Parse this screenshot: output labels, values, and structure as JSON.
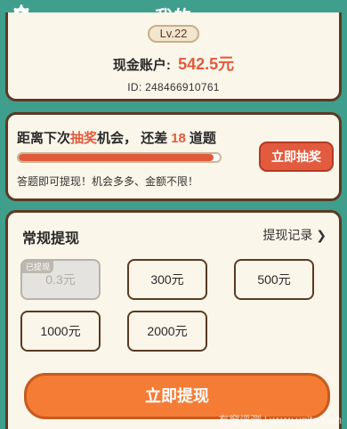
{
  "header": {
    "title": "我的",
    "settings_icon": "gear-icon"
  },
  "profile": {
    "level": "Lv.22",
    "balance_label": "现金账户:",
    "balance_amount": "542.5元",
    "id_text": "ID: 248466910761"
  },
  "lottery": {
    "text_pre": "距离下次",
    "text_highlight": "抽奖",
    "text_mid": "机会，  还差",
    "remaining": "18",
    "text_post": "道题",
    "progress_fraction": 0.97,
    "hint": "答题即可提现！机会多多、金额不限！",
    "button_label": "立即抽奖"
  },
  "withdraw": {
    "title": "常规提现",
    "record_link": "提现记录",
    "options": [
      {
        "label": "0.3元",
        "tag": "已提现",
        "disabled": true
      },
      {
        "label": "300元"
      },
      {
        "label": "500元"
      },
      {
        "label": "1000元"
      },
      {
        "label": "2000元"
      }
    ],
    "button_label": "立即提现"
  },
  "watermark": "有窗评测 | www.ugite.com",
  "colors": {
    "background": "#3f9f8c",
    "accent_red": "#e25a3c",
    "accent_orange": "#f57c35",
    "card": "#fbf6ea",
    "border": "#5b3a23"
  }
}
